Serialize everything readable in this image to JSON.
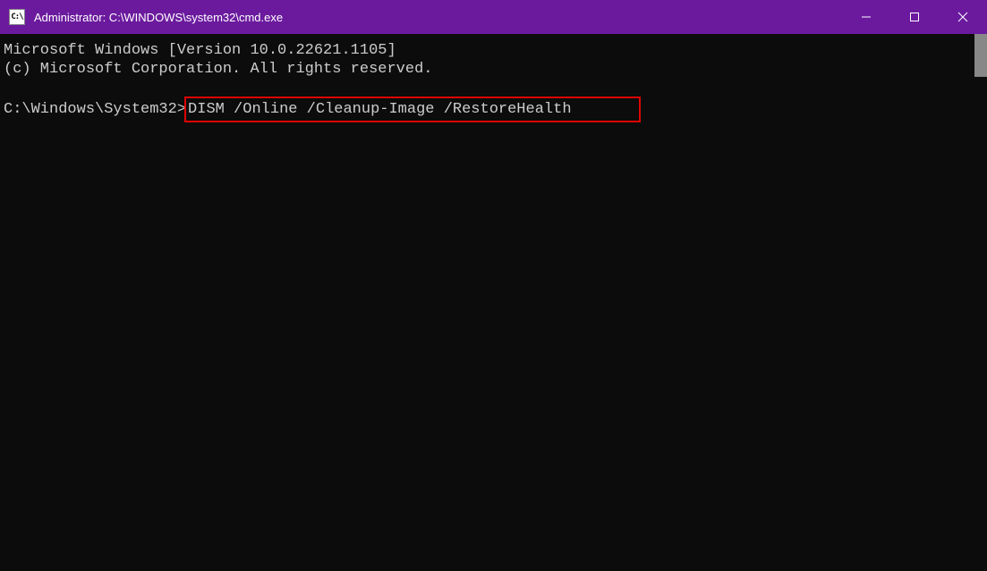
{
  "window": {
    "icon_text": "C:\\",
    "title": "Administrator: C:\\WINDOWS\\system32\\cmd.exe"
  },
  "terminal": {
    "line1": "Microsoft Windows [Version 10.0.22621.1105]",
    "line2": "(c) Microsoft Corporation. All rights reserved.",
    "prompt": "C:\\Windows\\System32>",
    "command": "DISM /Online /Cleanup-Image /RestoreHealth"
  }
}
